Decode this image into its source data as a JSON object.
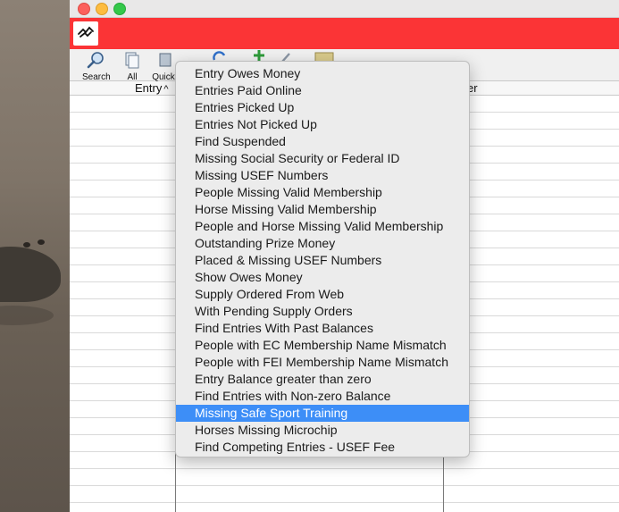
{
  "toolbar": {
    "buttons": [
      {
        "label": "Search",
        "icon": "search-icon"
      },
      {
        "label": "All",
        "icon": "document-icon"
      },
      {
        "label": "Quick",
        "icon": "quick-icon"
      }
    ]
  },
  "grid": {
    "columns": [
      "Entry",
      "er"
    ],
    "sort_indicator": "^"
  },
  "menu": {
    "selected_index": 20,
    "items": [
      "Entry Owes Money",
      "Entries Paid Online",
      "Entries Picked Up",
      "Entries Not Picked Up",
      "Find Suspended",
      "Missing Social Security or Federal ID",
      "Missing USEF Numbers",
      "People Missing Valid Membership",
      "Horse Missing Valid Membership",
      "People and Horse Missing Valid Membership",
      "Outstanding Prize Money",
      "Placed & Missing USEF Numbers",
      "Show Owes Money",
      "Supply Ordered From Web",
      "With Pending Supply Orders",
      "Find Entries With Past Balances",
      "People with EC Membership Name Mismatch",
      "People with FEI Membership Name Mismatch",
      "Entry Balance greater than zero",
      "Find Entries with Non-zero Balance",
      "Missing Safe Sport Training",
      "Horses Missing Microchip",
      "Find Competing Entries - USEF Fee"
    ]
  },
  "colors": {
    "brand_bar": "#fb3436",
    "selection": "#3d8ef7"
  }
}
